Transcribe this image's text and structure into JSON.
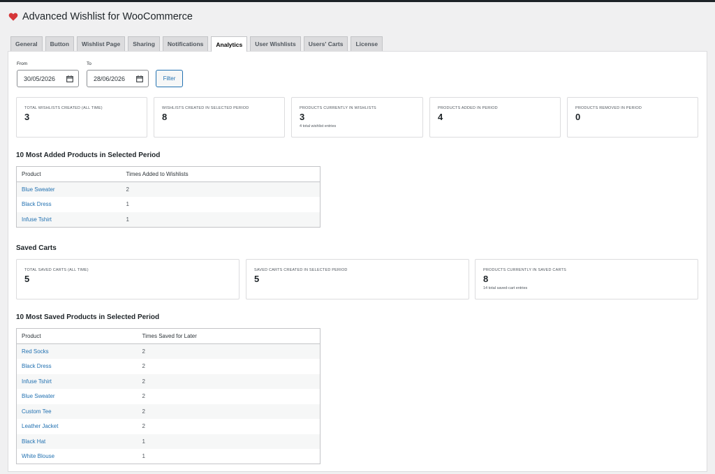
{
  "header": {
    "title": "Advanced Wishlist for WooCommerce",
    "accent": "#d63638"
  },
  "tabs": [
    {
      "label": "General",
      "active": false
    },
    {
      "label": "Button",
      "active": false
    },
    {
      "label": "Wishlist Page",
      "active": false
    },
    {
      "label": "Sharing",
      "active": false
    },
    {
      "label": "Notifications",
      "active": false
    },
    {
      "label": "Analytics",
      "active": true
    },
    {
      "label": "User Wishlists",
      "active": false
    },
    {
      "label": "Users' Carts",
      "active": false
    },
    {
      "label": "License",
      "active": false
    }
  ],
  "filter": {
    "from_label": "From",
    "from_value": "30/05/2026",
    "to_label": "To",
    "to_value": "28/06/2026",
    "button_label": "Filter"
  },
  "wishlist_stats": [
    {
      "label": "TOTAL WISHLISTS CREATED (ALL TIME)",
      "value": "3",
      "sub": ""
    },
    {
      "label": "WISHLISTS CREATED IN SELECTED PERIOD",
      "value": "8",
      "sub": ""
    },
    {
      "label": "PRODUCTS CURRENTLY IN WISHLISTS",
      "value": "3",
      "sub": "4 total wishlist entries"
    },
    {
      "label": "PRODUCTS ADDED IN PERIOD",
      "value": "4",
      "sub": ""
    },
    {
      "label": "PRODUCTS REMOVED IN PERIOD",
      "value": "0",
      "sub": ""
    }
  ],
  "most_added": {
    "title": "10 Most Added Products in Selected Period",
    "columns": [
      "Product",
      "Times Added to Wishlists"
    ],
    "rows": [
      {
        "product": "Blue Sweater",
        "count": "2"
      },
      {
        "product": "Black Dress",
        "count": "1"
      },
      {
        "product": "Infuse Tshirt",
        "count": "1"
      }
    ]
  },
  "saved_carts": {
    "title": "Saved Carts",
    "stats": [
      {
        "label": "TOTAL SAVED CARTS (ALL TIME)",
        "value": "5",
        "sub": ""
      },
      {
        "label": "SAVED CARTS CREATED IN SELECTED PERIOD",
        "value": "5",
        "sub": ""
      },
      {
        "label": "PRODUCTS CURRENTLY IN SAVED CARTS",
        "value": "8",
        "sub": "14 total saved-cart entries"
      }
    ]
  },
  "most_saved": {
    "title": "10 Most Saved Products in Selected Period",
    "columns": [
      "Product",
      "Times Saved for Later"
    ],
    "rows": [
      {
        "product": "Red Socks",
        "count": "2"
      },
      {
        "product": "Black Dress",
        "count": "2"
      },
      {
        "product": "Infuse Tshirt",
        "count": "2"
      },
      {
        "product": "Blue Sweater",
        "count": "2"
      },
      {
        "product": "Custom Tee",
        "count": "2"
      },
      {
        "product": "Leather Jacket",
        "count": "2"
      },
      {
        "product": "Black Hat",
        "count": "1"
      },
      {
        "product": "White Blouse",
        "count": "1"
      }
    ]
  }
}
